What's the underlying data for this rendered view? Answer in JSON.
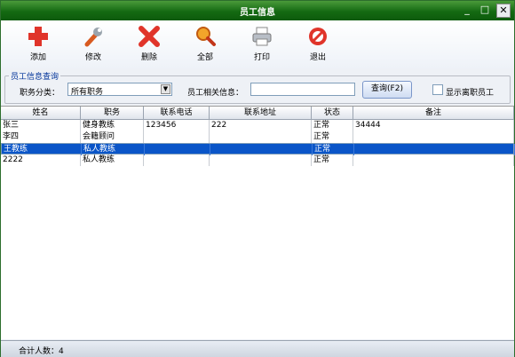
{
  "window": {
    "title": "员工信息"
  },
  "toolbar": {
    "add_label": "添加",
    "edit_label": "修改",
    "delete_label": "删除",
    "all_label": "全部",
    "print_label": "打印",
    "exit_label": "退出"
  },
  "query": {
    "group_title": "员工信息查询",
    "role_label": "职务分类：",
    "role_value": "所有职务",
    "info_label": "员工相关信息：",
    "info_value": "",
    "query_button": "查询(F2)",
    "show_resigned_label": "显示离职员工",
    "show_resigned_checked": false
  },
  "table": {
    "columns": [
      "姓名",
      "职务",
      "联系电话",
      "联系地址",
      "状态",
      "备注"
    ],
    "rows": [
      {
        "name": "张三",
        "role": "健身教练",
        "phone": "123456",
        "address": "222",
        "status": "正常",
        "note": "34444"
      },
      {
        "name": "李四",
        "role": "会籍顾问",
        "phone": "",
        "address": "",
        "status": "正常",
        "note": ""
      },
      {
        "name": "王教练",
        "role": "私人教练",
        "phone": "",
        "address": "",
        "status": "正常",
        "note": ""
      },
      {
        "name": "2222",
        "role": "私人教练",
        "phone": "",
        "address": "",
        "status": "正常",
        "note": ""
      }
    ],
    "selected_row": 2
  },
  "status": {
    "total_text": "合计人数：4"
  },
  "colors": {
    "titlebar": "#146a12",
    "selection": "#0a55c8"
  }
}
